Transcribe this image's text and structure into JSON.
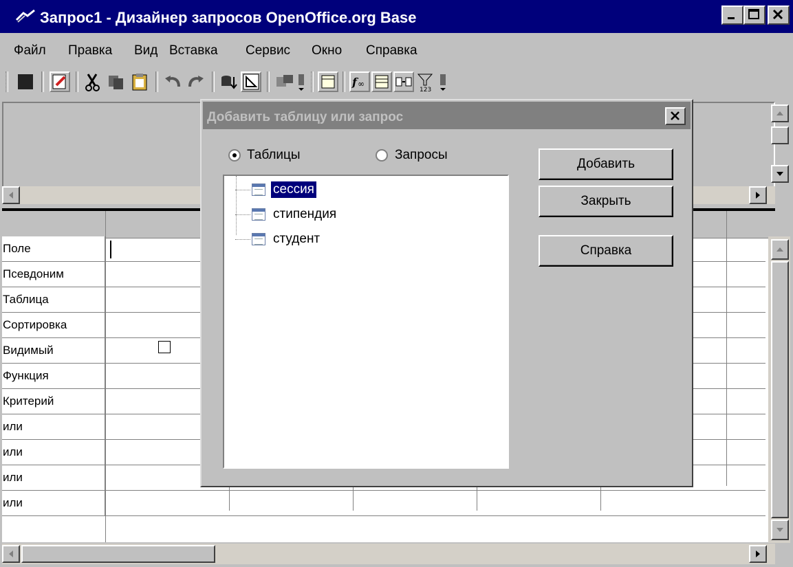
{
  "window": {
    "title": "Запрос1 - Дизайнер запросов OpenOffice.org Base"
  },
  "menu": [
    "Файл",
    "Правка",
    "Вид",
    "Вставка",
    "Сервис",
    "Окно",
    "Справка"
  ],
  "grid": {
    "row_labels": [
      "Поле",
      "Псевдоним",
      "Таблица",
      "Сортировка",
      "Видимый",
      "Функция",
      "Критерий",
      "или",
      "или",
      "или",
      "или"
    ]
  },
  "dialog": {
    "title": "Добавить таблицу или запрос",
    "radio_tables": "Таблицы",
    "radio_queries": "Запросы",
    "selected_radio": "tables",
    "items": [
      "сессия",
      "стипендия",
      "студент"
    ],
    "selected_item": "сессия",
    "btn_add": "Добавить",
    "btn_close": "Закрыть",
    "btn_help": "Справка"
  },
  "colors": {
    "titlebar": "#00007b",
    "selection": "#00007b"
  }
}
